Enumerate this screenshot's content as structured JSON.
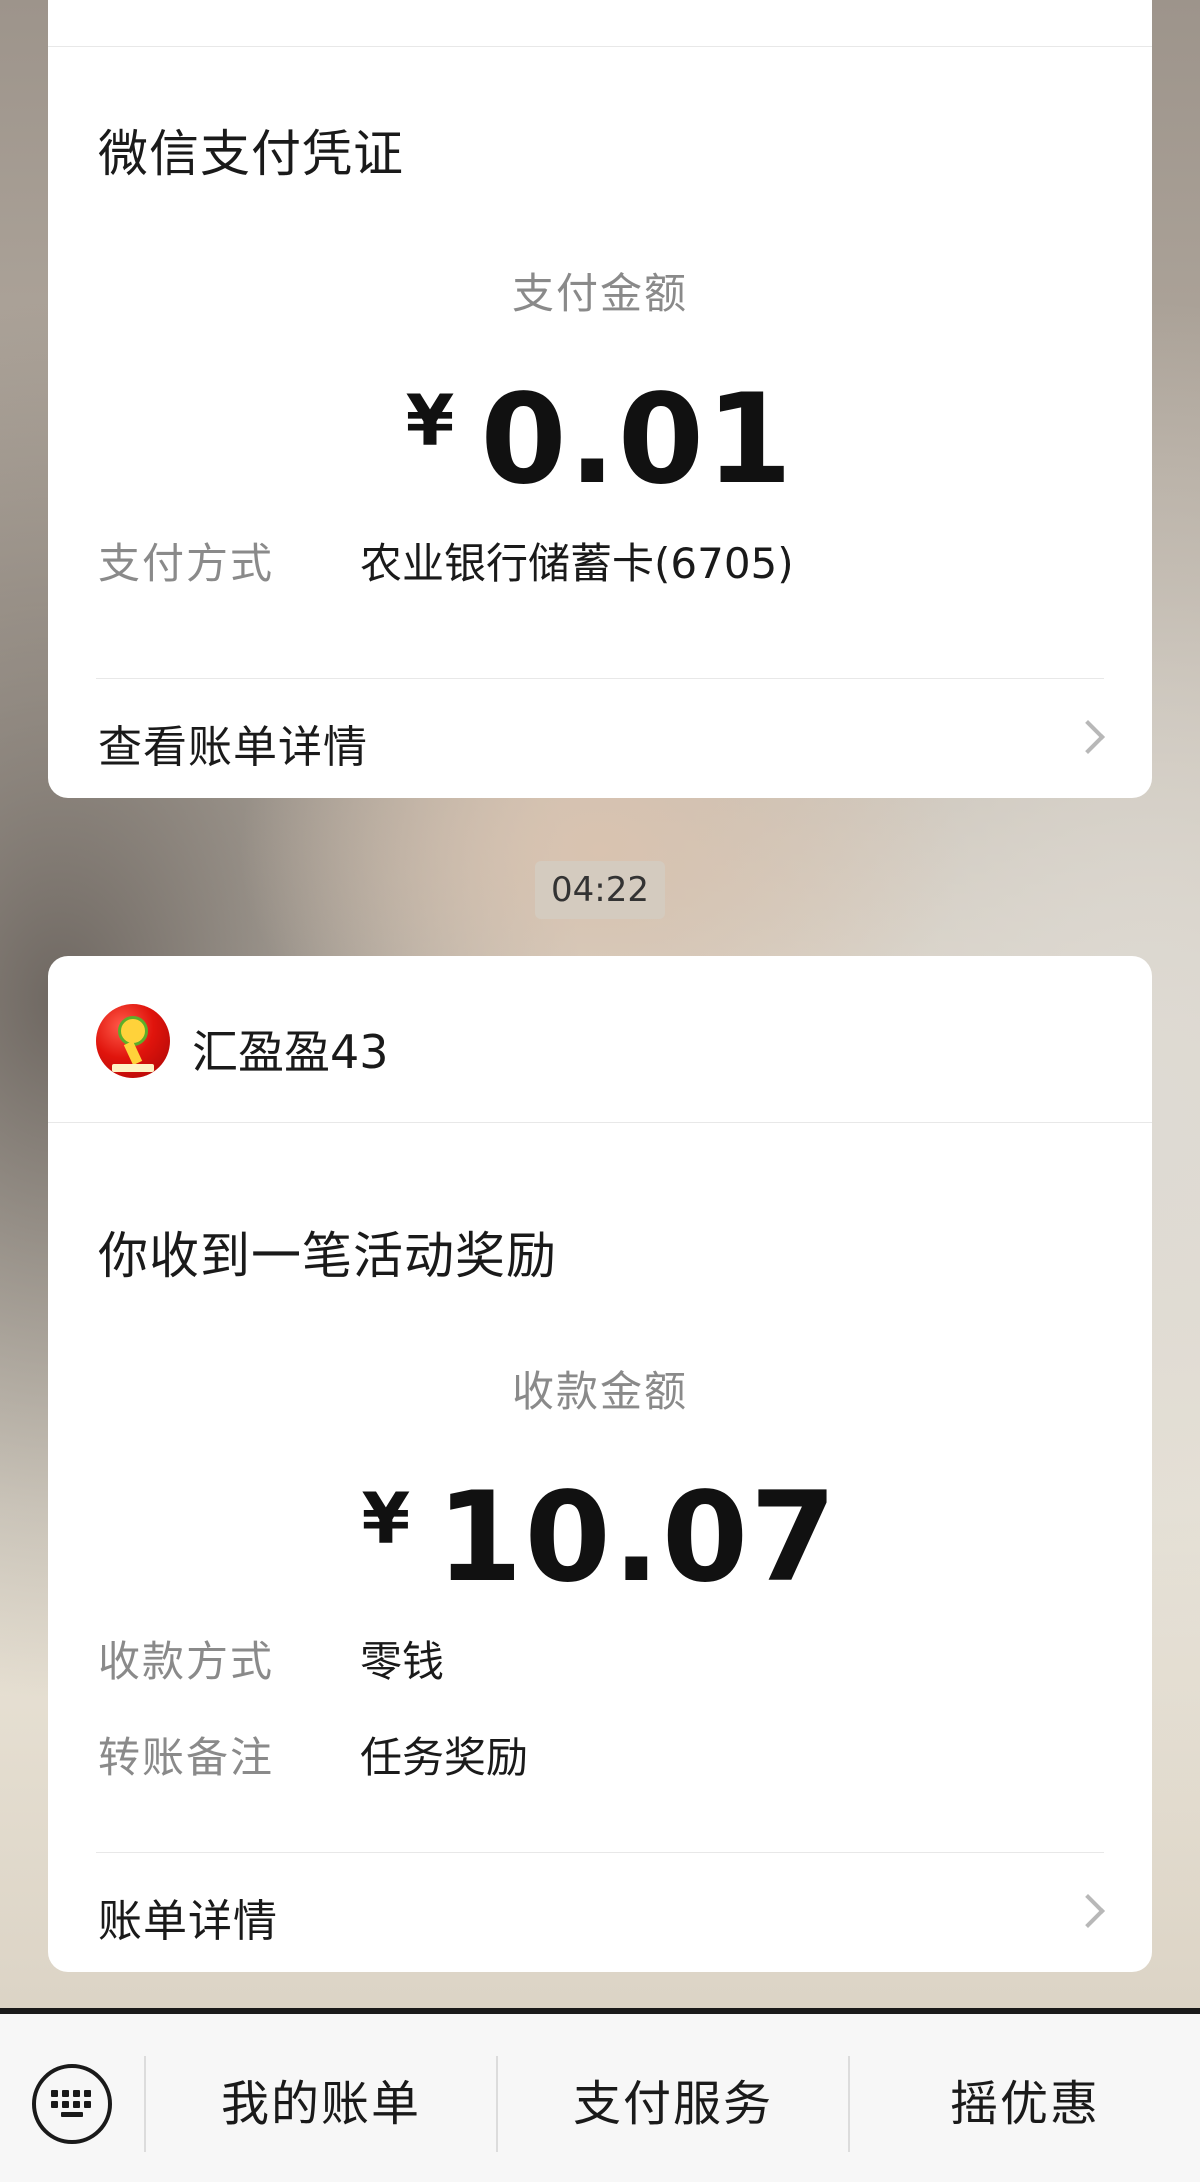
{
  "payment_card": {
    "title": "微信支付凭证",
    "amount_label": "支付金额",
    "currency": "¥",
    "amount": "0.01",
    "method_label": "支付方式",
    "method_value": "农业银行储蓄卡(6705)",
    "detail_link": "查看账单详情"
  },
  "time_badge": "04:22",
  "reward_card": {
    "sender": "汇盈盈43",
    "title": "你收到一笔活动奖励",
    "amount_label": "收款金额",
    "currency": "¥",
    "amount": "10.07",
    "method_label": "收款方式",
    "method_value": "零钱",
    "note_label": "转账备注",
    "note_value": "任务奖励",
    "detail_link": "账单详情"
  },
  "bottom_menu": {
    "items": [
      {
        "label": "我的账单"
      },
      {
        "label": "支付服务"
      },
      {
        "label": "摇优惠"
      }
    ]
  }
}
